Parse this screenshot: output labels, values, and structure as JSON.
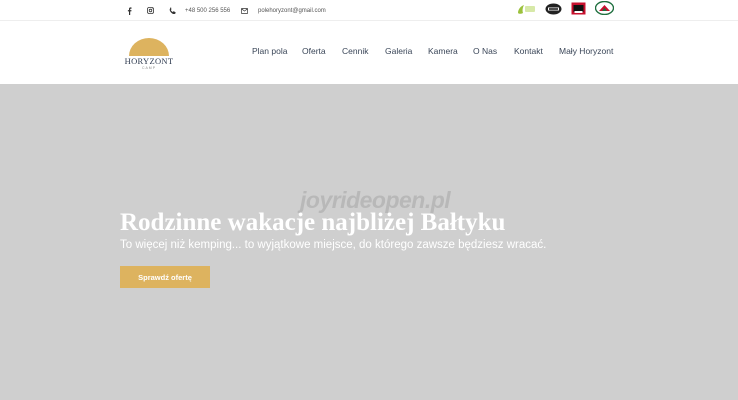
{
  "topbar": {
    "phone": "+48 500 256 556",
    "email": "polehoryzont@gmail.com",
    "icons": [
      "facebook-icon",
      "instagram-icon",
      "phone-icon",
      "mail-icon"
    ],
    "badges": [
      "eko-badge",
      "wifi-badge",
      "dog-friendly-badge",
      "camping-badge"
    ]
  },
  "logo": {
    "name": "HORYZONT",
    "tagline": "CAMP",
    "sun_color": "#ddb35f"
  },
  "nav": {
    "items": [
      "Plan pola",
      "Oferta",
      "Cennik",
      "Galeria",
      "Kamera",
      "O Nas",
      "Kontakt",
      "Mały Horyzont"
    ]
  },
  "hero": {
    "watermark": "joyrideopen.pl",
    "title": "Rodzinne wakacje najbliżej Bałtyku",
    "subtitle": "To więcej niż kemping... to wyjątkowe miejsce, do którego zawsze będziesz wracać.",
    "cta_label": "Sprawdź ofertę",
    "background_color": "#cfcfcf",
    "accent_color": "#ddb35f"
  }
}
